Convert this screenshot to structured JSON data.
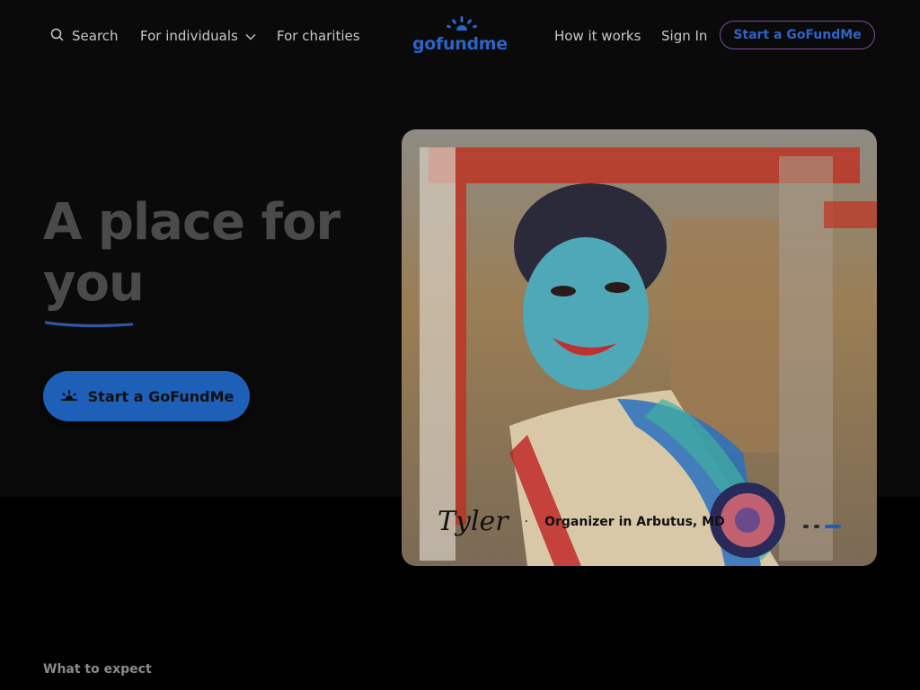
{
  "nav": {
    "search_label": "Search",
    "individuals_label": "For individuals",
    "charities_label": "For charities",
    "how_label": "How it works",
    "signin_label": "Sign In",
    "cta_label": "Start a GoFundMe",
    "logo_text": "gofundme"
  },
  "hero": {
    "title_line1": "A place for",
    "title_line2": "you",
    "cta_label": "Start a GoFundMe"
  },
  "photo": {
    "signature": "Tyler",
    "separator": "·",
    "organizer": "Organizer in Arbutus, MD",
    "slide_count": 3,
    "active_slide": 3
  },
  "section": {
    "label": "What to expect"
  },
  "colors": {
    "brand_blue": "#1e5fb8",
    "logo_blue": "#2a64c8",
    "cta_border": "#7a4fa0",
    "background_top": "#0a0a0a",
    "background_bottom": "#000000"
  },
  "icons": {
    "search": "search-icon",
    "chevron": "chevron-down-icon",
    "logo_mark": "sunrise-icon",
    "cta_icon": "sprout-icon"
  }
}
